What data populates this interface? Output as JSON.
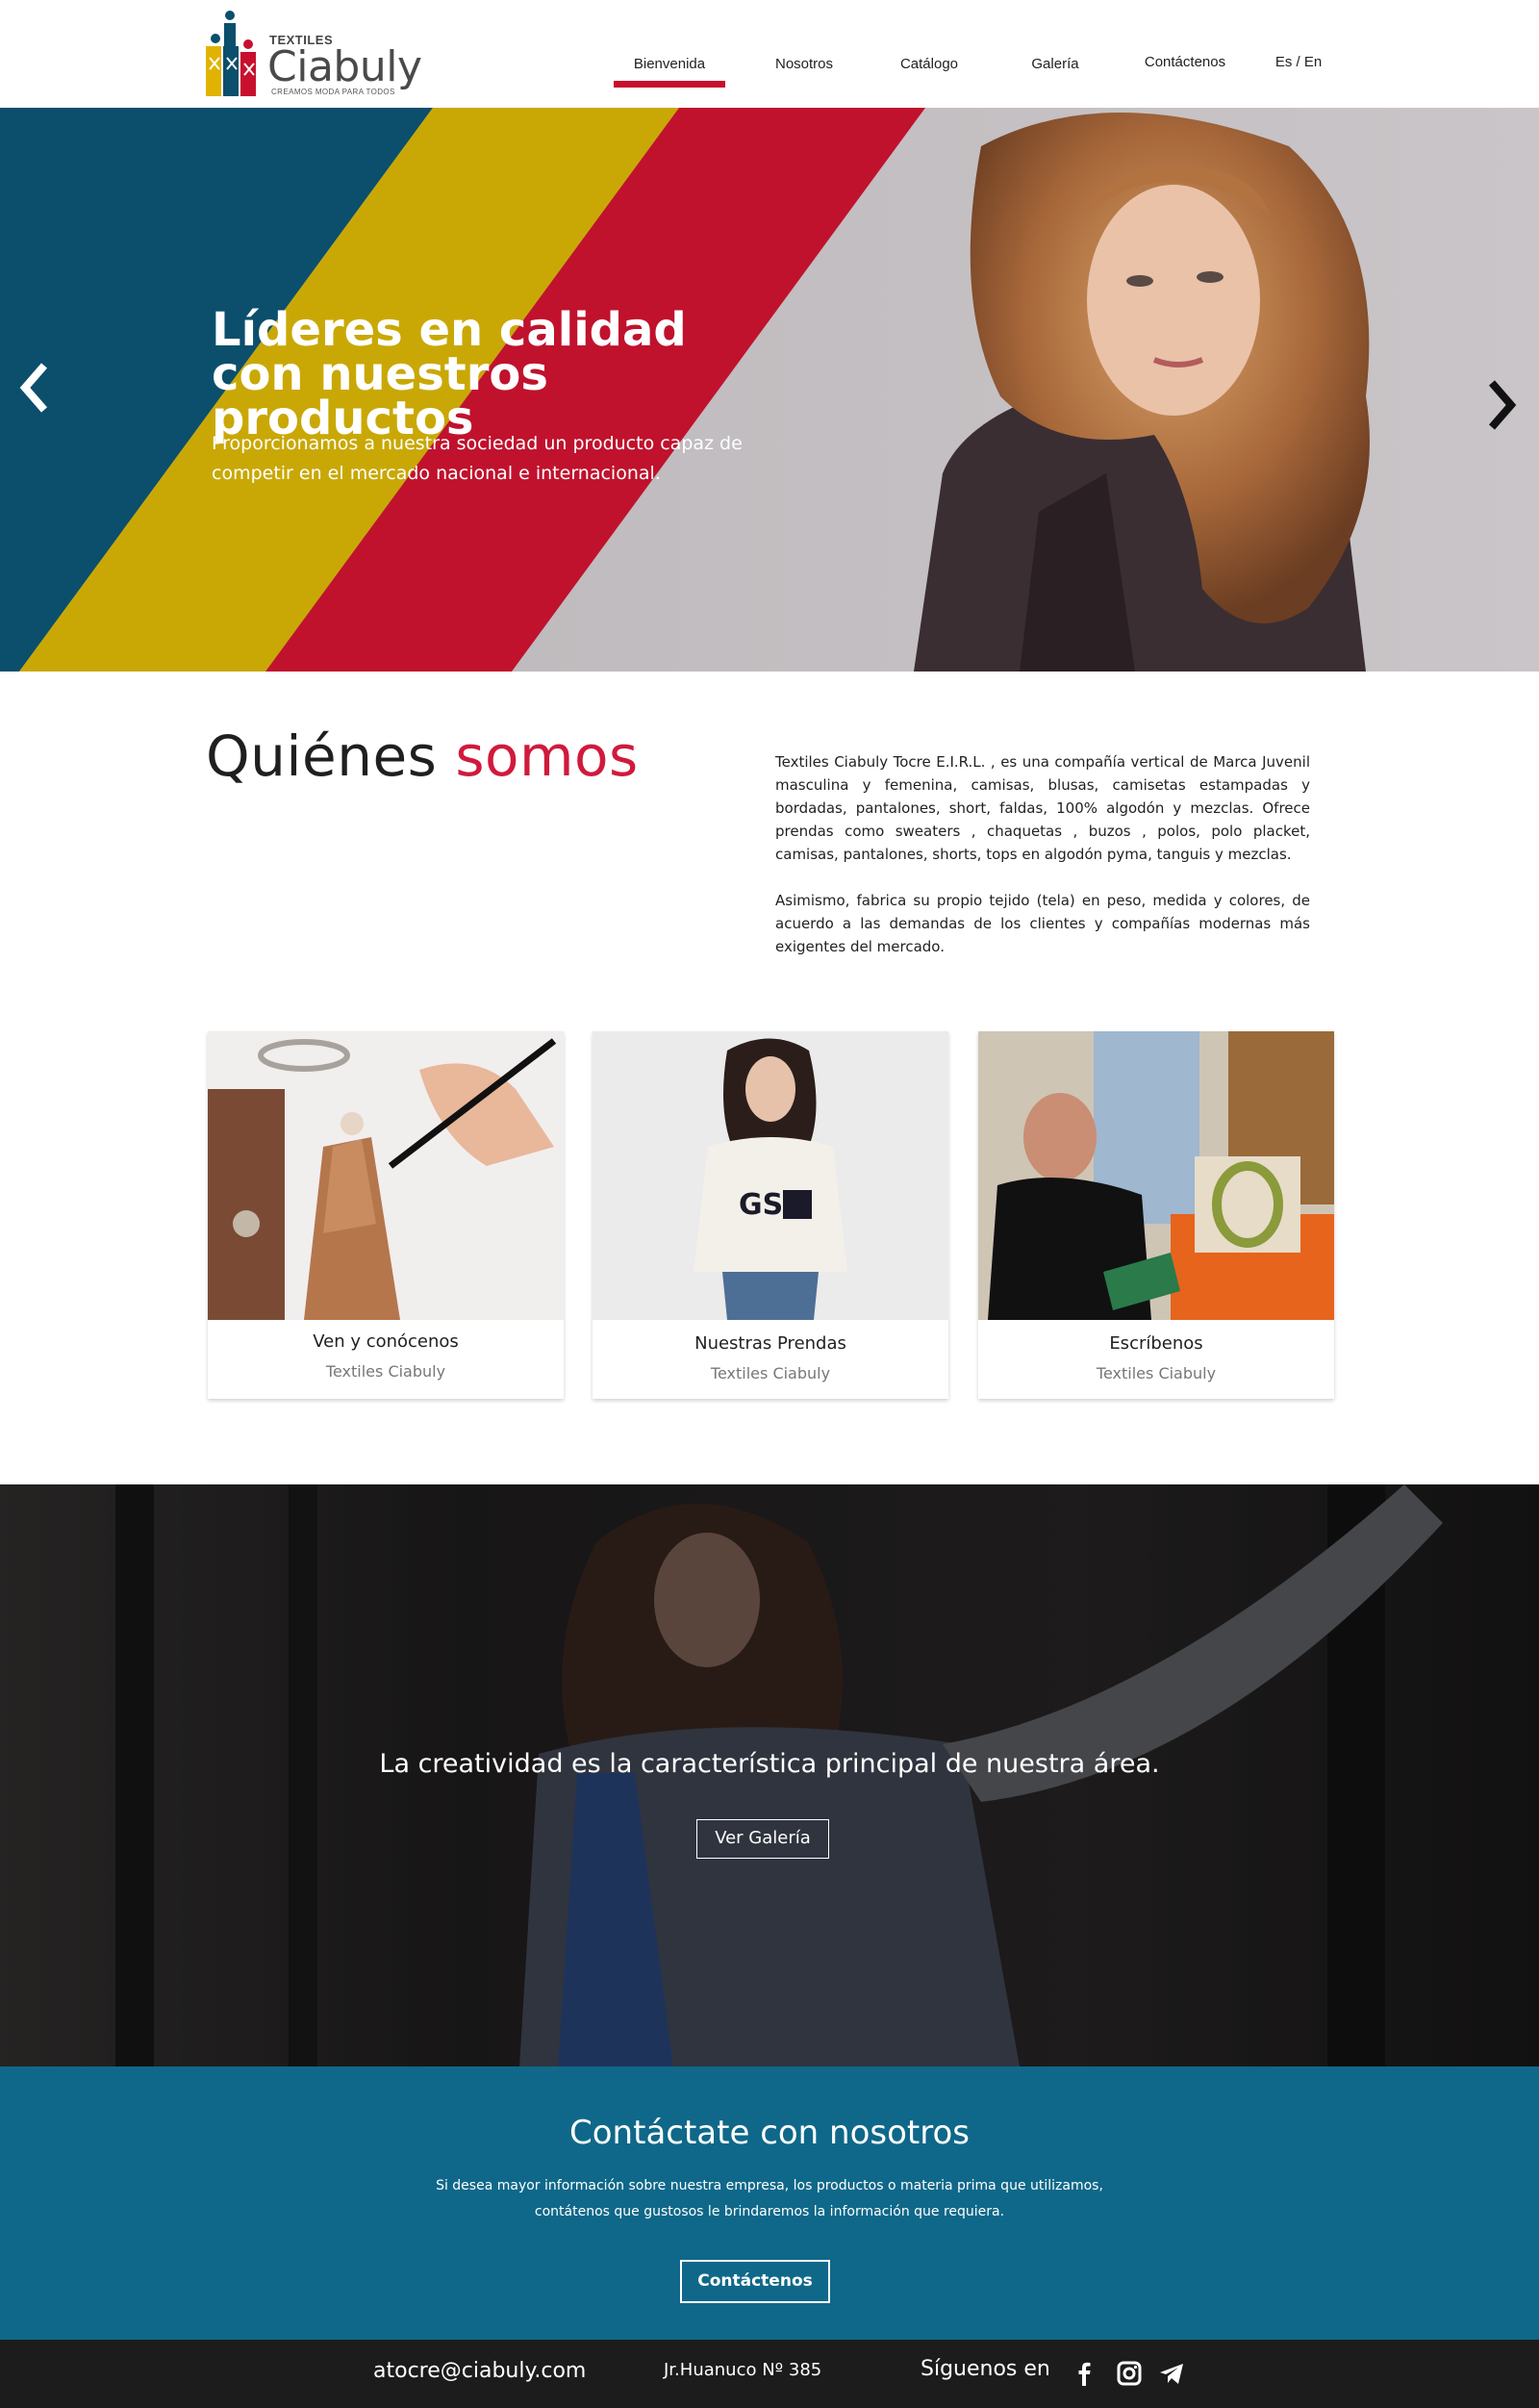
{
  "header": {
    "logo": {
      "small": "TEXTILES",
      "big": "Ciabuly",
      "tagline": "CREAMOS MODA PARA TODOS"
    },
    "nav": [
      {
        "label": "Bienvenida",
        "active": true
      },
      {
        "label": "Nosotros"
      },
      {
        "label": "Catálogo"
      },
      {
        "label": "Galería"
      },
      {
        "label": "Contáctenos"
      },
      {
        "label": "Es / En"
      }
    ],
    "accent_color": "#c8102e"
  },
  "hero": {
    "title_line1": "Líderes en calidad",
    "title_line2": "con nuestros productos",
    "subtitle_line1": "Proporcionamos a nuestra sociedad un producto capaz de",
    "subtitle_line2": "competir  en el mercado nacional e internacional.",
    "stripe_colors": [
      "#0b4f6c",
      "#c9a805",
      "#c0122d"
    ],
    "prev_icon": "chevron-left-icon",
    "next_icon": "chevron-right-icon"
  },
  "about": {
    "title_part1": "Quiénes ",
    "title_part2": "somos",
    "paragraph1": "Textiles Ciabuly Tocre E.I.R.L.  , es una compañía vertical de Marca Juvenil masculina y femenina, camisas, blusas, camisetas estampadas y bordadas, pantalones,  short, faldas, 100% algodón y mezclas. Ofrece prendas como sweaters , chaquetas , buzos , polos, polo placket, camisas, pantalones, shorts, tops en algodón pyma, tanguis y mezclas.",
    "paragraph2": "Asimismo, fabrica su propio tejido (tela) en peso, medida y colores, de acuerdo a las demandas de los clientes y compañías modernas más exigentes del mercado."
  },
  "cards": [
    {
      "title": "Ven y conócenos",
      "subtitle": "Textiles Ciabuly"
    },
    {
      "title": "Nuestras Prendas",
      "subtitle": "Textiles Ciabuly"
    },
    {
      "title": "Escríbenos",
      "subtitle": "Textiles Ciabuly"
    }
  ],
  "banner": {
    "text": "La creatividad es la característica principal de nuestra área.",
    "button": "Ver Galería"
  },
  "contact": {
    "title": "Contáctate con nosotros",
    "text_line1": "Si desea  mayor información sobre nuestra empresa, los productos o materia prima que utilizamos,",
    "text_line2": "contátenos que gustosos le brindaremos la información que requiera.",
    "button": "Contáctenos",
    "bg_color": "#0f6889"
  },
  "footer": {
    "email": "atocre@ciabuly.com",
    "address": "Jr.Huanuco Nº 385",
    "follow": "Síguenos en",
    "social_icons": [
      "facebook-icon",
      "instagram-icon",
      "telegram-icon"
    ]
  }
}
